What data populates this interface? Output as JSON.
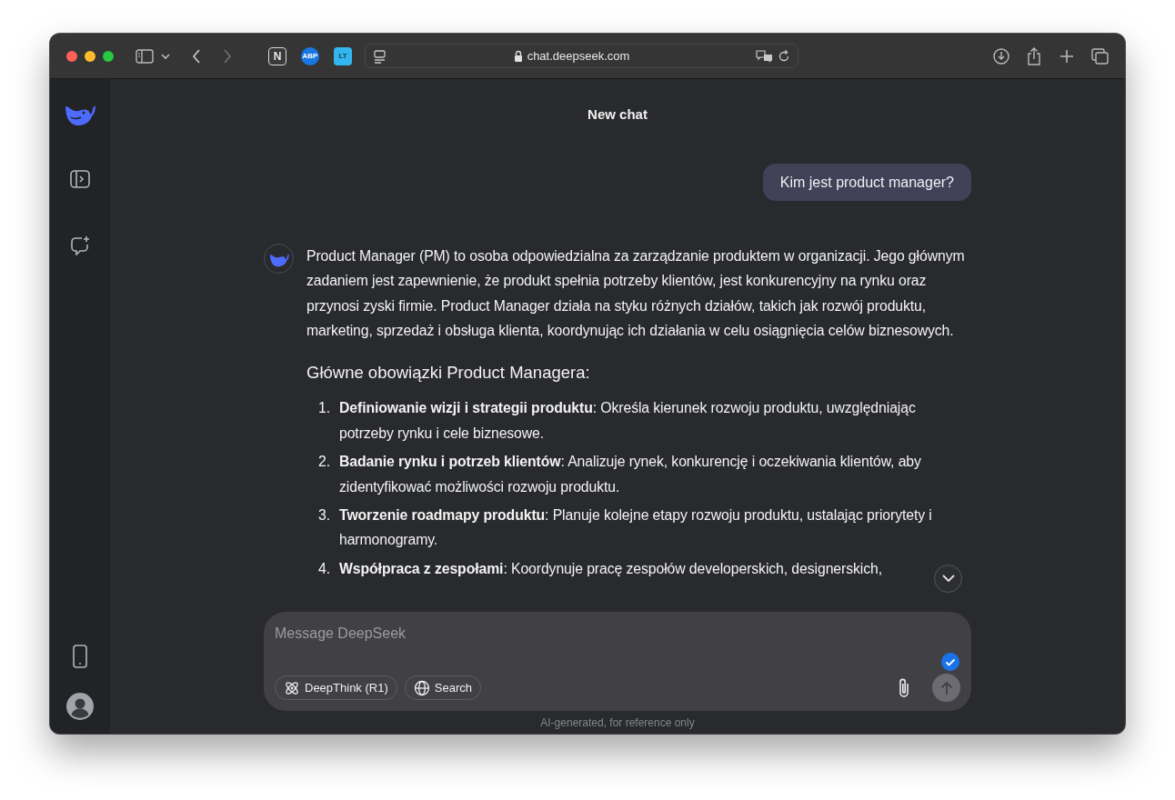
{
  "browser": {
    "extensions": [
      {
        "label": "N"
      },
      {
        "label": "ABP"
      },
      {
        "label": "LT"
      }
    ],
    "address": "chat.deepseek.com"
  },
  "chat": {
    "title": "New chat",
    "messages": [
      {
        "kind": "user",
        "text": "Kim jest product manager?"
      },
      {
        "kind": "assistant",
        "blocks": [
          {
            "kind": "paragraph",
            "text": "Product Manager (PM) to osoba odpowiedzialna za zarządzanie produktem w organizacji. Jego głównym zadaniem jest zapewnienie, że produkt spełnia potrzeby klientów, jest konkurencyjny na rynku oraz przynosi zyski firmie. Product Manager działa na styku różnych działów, takich jak rozwój produktu, marketing, sprzedaż i obsługa klienta, koordynując ich działania w celu osiągnięcia celów biznesowych."
          },
          {
            "kind": "heading",
            "text": "Główne obowiązki Product Managera:"
          },
          {
            "kind": "list",
            "items": [
              {
                "number": "1.",
                "text": "**Definiowanie wizji i strategii produktu**: Określa kierunek rozwoju produktu, uwzględniając potrzeby rynku i cele biznesowe."
              },
              {
                "number": "2.",
                "text": "**Badanie rynku i potrzeb klientów**: Analizuje rynek, konkurencję i oczekiwania klientów, aby zidentyfikować możliwości rozwoju produktu."
              },
              {
                "number": "3.",
                "text": "**Tworzenie roadmapy produktu**: Planuje kolejne etapy rozwoju produktu, ustalając priorytety i harmonogramy."
              },
              {
                "number": "4.",
                "text": "**Współpraca z zespołami**: Koordynuje pracę zespołów developerskich, designerskich,"
              }
            ]
          }
        ]
      }
    ]
  },
  "composer": {
    "placeholder": "Message DeepSeek",
    "options": [
      {
        "kind": "deepthink",
        "label": "DeepThink (R1)",
        "selected": false
      },
      {
        "kind": "search",
        "label": "Search",
        "selected": false
      }
    ],
    "footer": "AI-generated, for reference only"
  }
}
